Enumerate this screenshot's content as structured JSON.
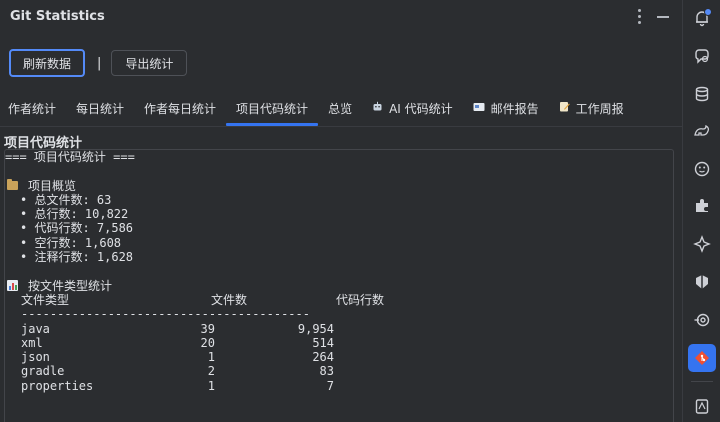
{
  "window": {
    "title": "Git Statistics"
  },
  "toolbar": {
    "refresh_label": "刷新数据",
    "separator": "|",
    "export_label": "导出统计"
  },
  "tabs": [
    {
      "label": "作者统计",
      "icon": ""
    },
    {
      "label": "每日统计",
      "icon": ""
    },
    {
      "label": "作者每日统计",
      "icon": ""
    },
    {
      "label": "项目代码统计",
      "icon": "",
      "active": true
    },
    {
      "label": "总览",
      "icon": ""
    },
    {
      "label": "AI 代码统计",
      "icon": "robot-icon"
    },
    {
      "label": "邮件报告",
      "icon": "mail-icon"
    },
    {
      "label": "工作周报",
      "icon": "memo-icon"
    }
  ],
  "section": {
    "title": "项目代码统计"
  },
  "report": {
    "header": "=== 项目代码统计 ===",
    "overview": {
      "title": "项目概览",
      "items": [
        "• 总文件数: 63",
        "• 总行数: 10,822",
        "• 代码行数: 7,586",
        "• 空行数: 1,608",
        "• 注释行数: 1,628"
      ]
    },
    "by_type": {
      "title": "按文件类型统计",
      "columns": [
        "文件类型",
        "文件数",
        "代码行数"
      ],
      "rule": "----------------------------------------",
      "rows": [
        {
          "type": "java",
          "files": "39",
          "lines": "9,954"
        },
        {
          "type": "xml",
          "files": "20",
          "lines": "514"
        },
        {
          "type": "json",
          "files": "1",
          "lines": "264"
        },
        {
          "type": "gradle",
          "files": "2",
          "lines": "83"
        },
        {
          "type": "properties",
          "files": "1",
          "lines": "7"
        }
      ]
    }
  },
  "colors": {
    "background": "#2b2d30",
    "accent": "#3574f0",
    "text": "#dfe1e5",
    "border": "#43454a"
  },
  "strip_icons": [
    "notifications-icon",
    "ai-chat-icon",
    "database-icon",
    "gradle-icon",
    "plugin-face-icon",
    "puzzle-icon",
    "ai-sparkle-icon",
    "coverage-icon",
    "endpoints-icon",
    "git-statistics-icon",
    "docs-icon"
  ]
}
